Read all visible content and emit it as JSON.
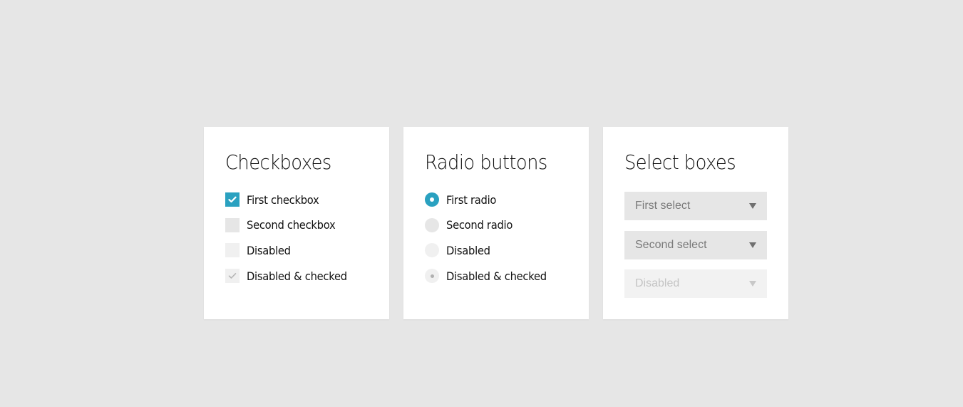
{
  "colors": {
    "accent": "#2aa1c0",
    "page_background": "#e6e6e6",
    "card_background": "#ffffff",
    "control_background": "#e6e6e6",
    "control_disabled_background": "#f0f0f0"
  },
  "checkboxes": {
    "title": "Checkboxes",
    "items": [
      {
        "label": "First checkbox",
        "checked": true,
        "disabled": false,
        "icon": "check-icon"
      },
      {
        "label": "Second checkbox",
        "checked": false,
        "disabled": false
      },
      {
        "label": "Disabled",
        "checked": false,
        "disabled": true
      },
      {
        "label": "Disabled & checked",
        "checked": true,
        "disabled": true,
        "icon": "check-icon"
      }
    ]
  },
  "radios": {
    "title": "Radio buttons",
    "items": [
      {
        "label": "First radio",
        "checked": true,
        "disabled": false
      },
      {
        "label": "Second radio",
        "checked": false,
        "disabled": false
      },
      {
        "label": "Disabled",
        "checked": false,
        "disabled": true
      },
      {
        "label": "Disabled & checked",
        "checked": true,
        "disabled": true
      }
    ]
  },
  "selects": {
    "title": "Select boxes",
    "items": [
      {
        "value": "First select",
        "disabled": false,
        "icon": "caret-down-icon"
      },
      {
        "value": "Second select",
        "disabled": false,
        "icon": "caret-down-icon"
      },
      {
        "value": "Disabled",
        "disabled": true,
        "icon": "caret-down-icon"
      }
    ]
  }
}
